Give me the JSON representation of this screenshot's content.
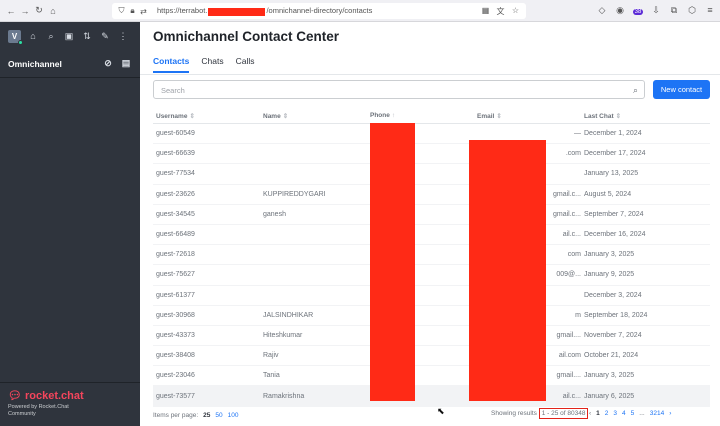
{
  "browser": {
    "url_prefix": "https://terrabot.",
    "url_suffix": "/omnichannel-directory/contacts",
    "ext_badge": "38"
  },
  "sidebar": {
    "avatar_letter": "V",
    "section_label": "Omnichannel",
    "brand": "rocket.chat",
    "powered_by": "Powered by Rocket.Chat",
    "edition": "Community"
  },
  "main": {
    "title": "Omnichannel Contact Center",
    "tabs": [
      {
        "label": "Contacts",
        "active": true
      },
      {
        "label": "Chats",
        "active": false
      },
      {
        "label": "Calls",
        "active": false
      }
    ],
    "search_placeholder": "Search",
    "new_contact_label": "New contact"
  },
  "table": {
    "columns": [
      "Username",
      "Name",
      "Phone",
      "Email",
      "Last Chat"
    ],
    "rows": [
      {
        "username": "guest-60549",
        "name": "",
        "email": "—",
        "last_chat": "December 1, 2024"
      },
      {
        "username": "guest-66639",
        "name": "",
        "email": ".com",
        "last_chat": "December 17, 2024"
      },
      {
        "username": "guest-77534",
        "name": "",
        "email": "",
        "last_chat": "January 13, 2025"
      },
      {
        "username": "guest-23626",
        "name": "KUPPIREDDYGARI",
        "email": "gmail.c...",
        "last_chat": "August 5, 2024"
      },
      {
        "username": "guest-34545",
        "name": "ganesh",
        "email": "gmail.c...",
        "last_chat": "September 7, 2024"
      },
      {
        "username": "guest-66489",
        "name": "",
        "email": "ail.c...",
        "last_chat": "December 16, 2024"
      },
      {
        "username": "guest-72618",
        "name": "",
        "email": "com",
        "last_chat": "January 3, 2025"
      },
      {
        "username": "guest-75627",
        "name": "",
        "email": "009@...",
        "last_chat": "January 9, 2025"
      },
      {
        "username": "guest-61377",
        "name": "",
        "email": "",
        "last_chat": "December 3, 2024"
      },
      {
        "username": "guest-30968",
        "name": "JALSINDHIKAR",
        "email": "m",
        "last_chat": "September 18, 2024"
      },
      {
        "username": "guest-43373",
        "name": "Hiteshkumar",
        "email": "gmail....",
        "last_chat": "November 7, 2024"
      },
      {
        "username": "guest-38408",
        "name": "Rajiv",
        "email": "ail.com",
        "last_chat": "October 21, 2024"
      },
      {
        "username": "guest-23046",
        "name": "Tania",
        "email": "gmail....",
        "last_chat": "January 3, 2025"
      },
      {
        "username": "guest-73577",
        "name": "Ramakrishna",
        "email": "ail.c...",
        "last_chat": "January 6, 2025"
      }
    ]
  },
  "footer": {
    "items_per_page_label": "Items per page:",
    "page_sizes": [
      "25",
      "50",
      "100"
    ],
    "showing_label": "Showing results",
    "range": "1 - 25 of 80348",
    "pages": [
      "1",
      "2",
      "3",
      "4",
      "5",
      "...",
      "3214"
    ]
  }
}
